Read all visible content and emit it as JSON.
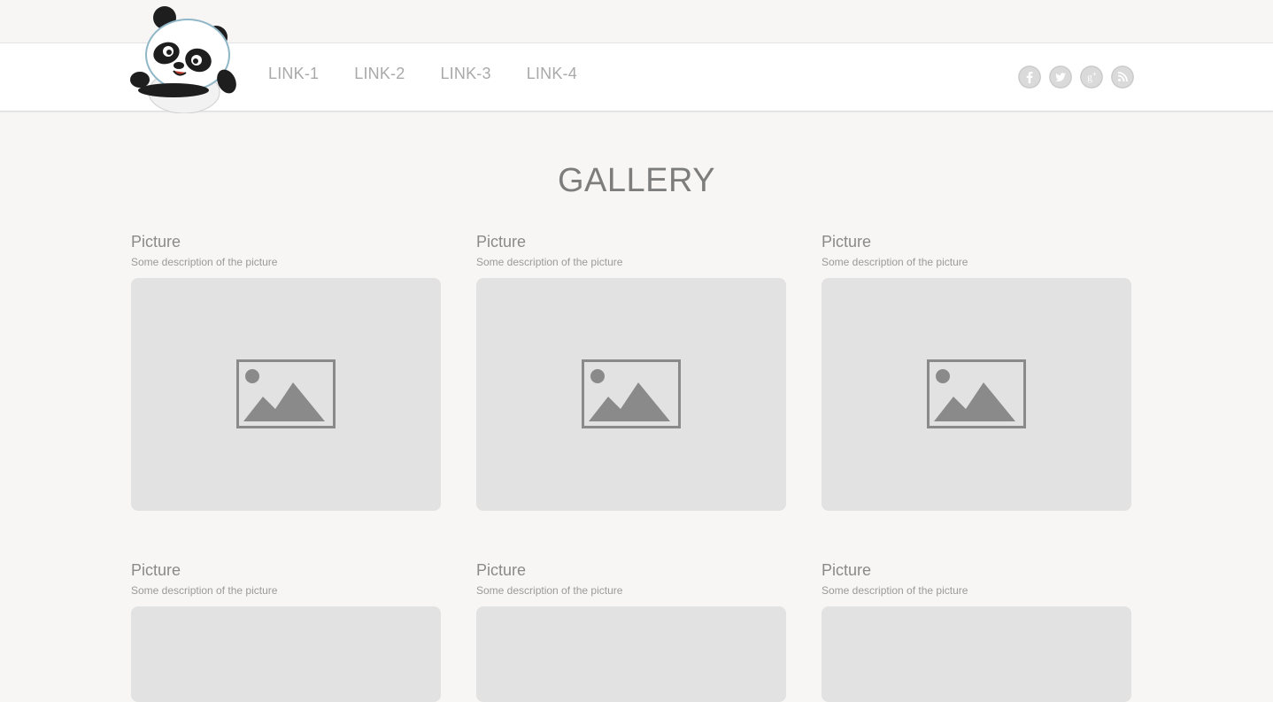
{
  "nav": {
    "links": [
      "LINK-1",
      "LINK-2",
      "LINK-3",
      "LINK-4"
    ]
  },
  "social": {
    "icons": [
      "facebook-icon",
      "twitter-icon",
      "google-plus-icon",
      "rss-icon"
    ]
  },
  "gallery": {
    "title": "GALLERY",
    "items": [
      {
        "title": "Picture",
        "description": "Some description of the picture"
      },
      {
        "title": "Picture",
        "description": "Some description of the picture"
      },
      {
        "title": "Picture",
        "description": "Some description of the picture"
      },
      {
        "title": "Picture",
        "description": "Some description of the picture"
      },
      {
        "title": "Picture",
        "description": "Some description of the picture"
      },
      {
        "title": "Picture",
        "description": "Some description of the picture"
      }
    ]
  },
  "colors": {
    "background": "#f7f6f5",
    "header": "#ffffff",
    "placeholder": "#e2e2e2",
    "placeholder_icon": "#8a8a8a",
    "text": "#8a8a8a"
  }
}
